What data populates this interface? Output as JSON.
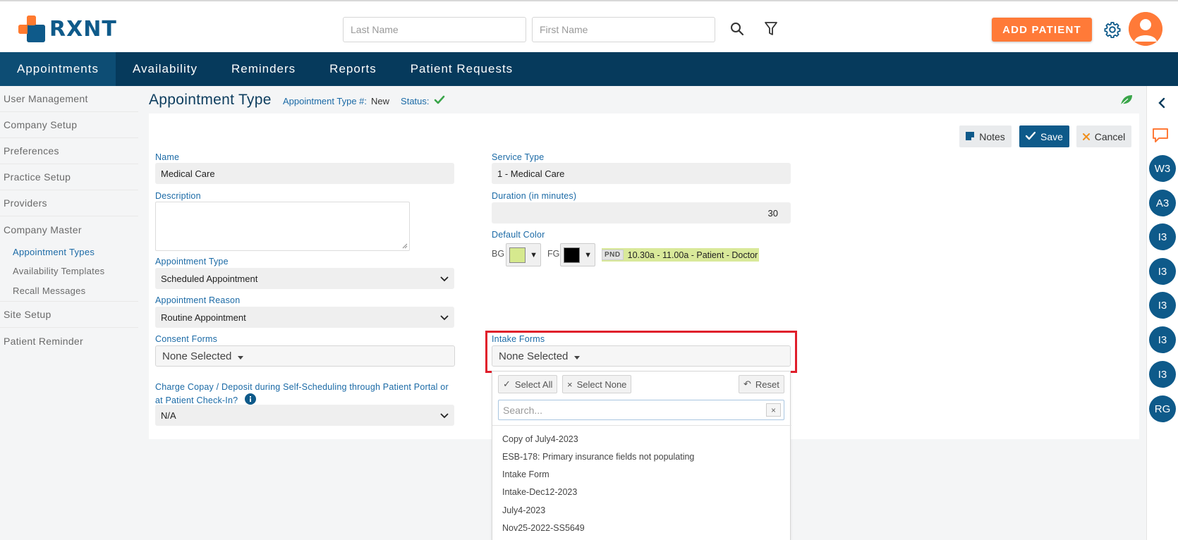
{
  "brand": {
    "name": "RXNT",
    "accent": "#ff7a38",
    "primary": "#0e5a8a",
    "nav_bg": "#063a5c"
  },
  "search": {
    "last_name_placeholder": "Last Name",
    "first_name_placeholder": "First Name"
  },
  "header": {
    "add_patient_label": "ADD PATIENT"
  },
  "nav": {
    "items": [
      {
        "label": "Appointments"
      },
      {
        "label": "Availability"
      },
      {
        "label": "Reminders"
      },
      {
        "label": "Reports"
      },
      {
        "label": "Patient Requests"
      }
    ]
  },
  "sidebar": {
    "items": [
      {
        "label": "User Management"
      },
      {
        "label": "Company Setup"
      },
      {
        "label": "Preferences"
      },
      {
        "label": "Practice Setup"
      },
      {
        "label": "Providers"
      },
      {
        "label": "Company Master"
      }
    ],
    "subitems": [
      {
        "label": "Appointment Types"
      },
      {
        "label": "Availability Templates"
      },
      {
        "label": "Recall Messages"
      }
    ],
    "bottom_items": [
      {
        "label": "Site Setup"
      },
      {
        "label": "Patient Reminder"
      }
    ]
  },
  "page": {
    "title": "Appointment Type",
    "type_num_label": "Appointment Type #:",
    "type_num_value": "New",
    "status_label": "Status:"
  },
  "toolbar": {
    "notes_label": "Notes",
    "save_label": "Save",
    "cancel_label": "Cancel"
  },
  "form": {
    "name_label": "Name",
    "name_value": "Medical Care",
    "description_label": "Description",
    "appointment_type_label": "Appointment Type",
    "appointment_type_value": "Scheduled Appointment",
    "appointment_reason_label": "Appointment Reason",
    "appointment_reason_value": "Routine Appointment",
    "consent_forms_label": "Consent Forms",
    "consent_forms_value": "None Selected",
    "charge_copay_label": "Charge Copay / Deposit during Self-Scheduling through Patient Portal or at Patient Check-In?",
    "charge_copay_value": "N/A",
    "service_type_label": "Service Type",
    "service_type_value": "1 - Medical Care",
    "duration_label": "Duration (in minutes)",
    "duration_value": "30",
    "default_color_label": "Default Color",
    "bg_label": "BG",
    "fg_label": "FG",
    "bg_color": "#d6e98e",
    "fg_color": "#000000",
    "preview_tag": "PND",
    "preview_text": "10.30a - 11.00a - Patient - Doctor",
    "intake_forms_label": "Intake Forms",
    "intake_forms_value": "None Selected"
  },
  "dropdown": {
    "select_all_label": "Select All",
    "select_none_label": "Select None",
    "reset_label": "Reset",
    "search_placeholder": "Search...",
    "clear_label": "×",
    "options": [
      "Copy of July4-2023",
      "ESB-178: Primary insurance fields not populating",
      "Intake Form",
      "Intake-Dec12-2023",
      "July4-2023",
      "Nov25-2022-SS5649"
    ]
  },
  "rail": {
    "badges": [
      "W3",
      "A3",
      "I3",
      "I3",
      "I3",
      "I3",
      "I3",
      "RG"
    ]
  }
}
